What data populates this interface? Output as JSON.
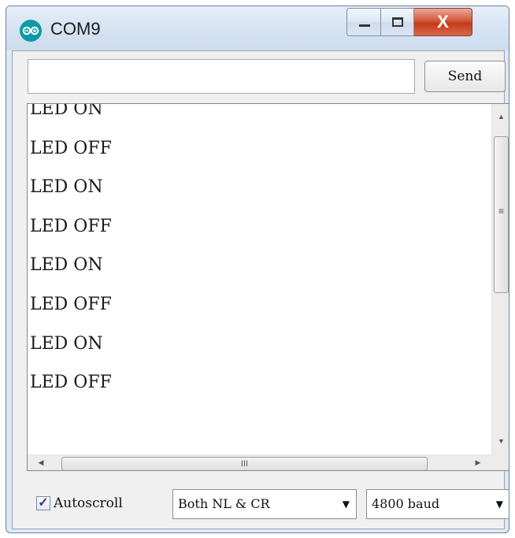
{
  "window": {
    "title": "COM9",
    "app_icon": "arduino-icon",
    "close_glyph": "X"
  },
  "send_area": {
    "input_value": "",
    "send_label": "Send"
  },
  "output": {
    "lines": [
      "LED ON",
      "LED OFF",
      "LED ON",
      "LED OFF",
      "LED ON",
      "LED OFF",
      "LED ON",
      "LED OFF"
    ]
  },
  "scrollbars": {
    "vertical_grip": "≡",
    "horizontal_grip": "III"
  },
  "bottom": {
    "autoscroll_label": "Autoscroll",
    "autoscroll_checked": true,
    "line_ending": "Both NL & CR",
    "baud_rate": "4800 baud"
  },
  "colors": {
    "app_icon": "#0b9aa6",
    "close_button": "#c43a1c",
    "title_bar": "#dfe9f5"
  }
}
